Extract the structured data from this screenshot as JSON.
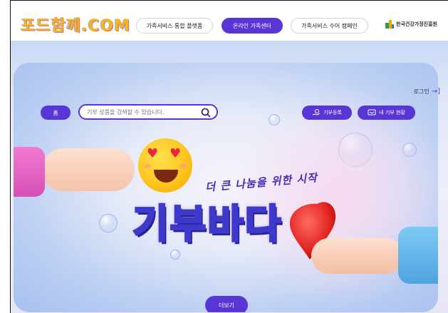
{
  "header": {
    "logo_text": "포드함께.COM",
    "nav": [
      {
        "label": "가족서비스 통합 플랫폼",
        "active": false
      },
      {
        "label": "온라인 가족센터",
        "active": true
      },
      {
        "label": "가족서비스 수어 캠페인",
        "active": false
      }
    ],
    "org_name": "한국건강가정진흥원",
    "accent_color": "#5a35d6"
  },
  "login": {
    "label": "로그인",
    "icon": "arrow-right-icon"
  },
  "banner": {
    "home_label": "홈",
    "search_placeholder": "기부 상품을 검색할 수 있습니다.",
    "donate_register_label": "기부등록",
    "my_donation_label": "내 기부 현황",
    "tagline": "더 큰 나눔을 위한 시작",
    "title": "기부바다",
    "more_label": "더보기"
  }
}
